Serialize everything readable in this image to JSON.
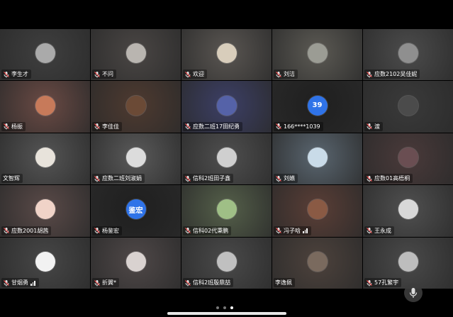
{
  "participants": [
    {
      "name": "李生才",
      "muted": true,
      "bg": "#3f3f3f",
      "avatar_bg": "#aaaaaa",
      "avatar_text": "",
      "signal": false
    },
    {
      "name": "不问",
      "muted": true,
      "bg": "#4a4644",
      "avatar_bg": "#b9b5b0",
      "avatar_text": "",
      "signal": false
    },
    {
      "name": "欢迎",
      "muted": true,
      "bg": "#5a5652",
      "avatar_bg": "#d8cdbb",
      "avatar_text": "",
      "signal": false
    },
    {
      "name": "刘洁",
      "muted": true,
      "bg": "#5c5a54",
      "avatar_bg": "#9b9c94",
      "avatar_text": "",
      "signal": false
    },
    {
      "name": "应数2102吴佳妮",
      "muted": true,
      "bg": "#4c4c4c",
      "avatar_bg": "#8f8f8f",
      "avatar_text": "",
      "signal": false
    },
    {
      "name": "杨振",
      "muted": true,
      "bg": "#6a4a44",
      "avatar_bg": "#c77a5a",
      "avatar_text": "",
      "signal": false
    },
    {
      "name": "李佳佳",
      "muted": true,
      "bg": "#4e3a30",
      "avatar_bg": "#6b4a36",
      "avatar_text": "",
      "signal": false
    },
    {
      "name": "应数二班17田纪勇",
      "muted": true,
      "bg": "#3c3f66",
      "avatar_bg": "#5562a8",
      "avatar_text": "",
      "signal": false
    },
    {
      "name": "166****1039",
      "muted": true,
      "bg": "#1f1f1f",
      "avatar_bg": "#2f73e8",
      "avatar_text": "39",
      "signal": false
    },
    {
      "name": "渡",
      "muted": true,
      "bg": "#3a3a3a",
      "avatar_bg": "#4b4b4b",
      "avatar_text": "",
      "signal": false
    },
    {
      "name": "文智辉",
      "muted": false,
      "bg": "#555555",
      "avatar_bg": "#e8e3db",
      "avatar_text": "",
      "signal": false
    },
    {
      "name": "应数二班刘淑娟",
      "muted": true,
      "bg": "#5a5a5a",
      "avatar_bg": "#dcdcdc",
      "avatar_text": "",
      "signal": false
    },
    {
      "name": "信科2班田子鑫",
      "muted": true,
      "bg": "#4f4f4f",
      "avatar_bg": "#cfcfcf",
      "avatar_text": "",
      "signal": false
    },
    {
      "name": "刘嬿",
      "muted": true,
      "bg": "#5a6670",
      "avatar_bg": "#c9dbe8",
      "avatar_text": "",
      "signal": false
    },
    {
      "name": "应数01高梧桐",
      "muted": true,
      "bg": "#4a3a3a",
      "avatar_bg": "#6a4e52",
      "avatar_text": "",
      "signal": false
    },
    {
      "name": "应数2001胡茜",
      "muted": true,
      "bg": "#5a4a48",
      "avatar_bg": "#f0d3c8",
      "avatar_text": "",
      "signal": false
    },
    {
      "name": "杨鉴宏",
      "muted": true,
      "bg": "#1f1f1f",
      "avatar_bg": "#2f73e8",
      "avatar_text": "鉴宏",
      "signal": false
    },
    {
      "name": "信科02代秉鹏",
      "muted": true,
      "bg": "#55604a",
      "avatar_bg": "#9fbf86",
      "avatar_text": "",
      "signal": false
    },
    {
      "name": "冯子晗",
      "muted": true,
      "bg": "#5a3e36",
      "avatar_bg": "#8a5a44",
      "avatar_text": "",
      "signal": true
    },
    {
      "name": "王永成",
      "muted": true,
      "bg": "#505050",
      "avatar_bg": "#d8d8d8",
      "avatar_text": "",
      "signal": false
    },
    {
      "name": "甘烟勇",
      "muted": true,
      "bg": "#474747",
      "avatar_bg": "#f2f2f2",
      "avatar_text": "",
      "signal": true
    },
    {
      "name": "折翼*",
      "muted": true,
      "bg": "#4f4848",
      "avatar_bg": "#d9d2d0",
      "avatar_text": "",
      "signal": false
    },
    {
      "name": "信科2班殷鼎喆",
      "muted": true,
      "bg": "#4a4a4a",
      "avatar_bg": "#c0c0c0",
      "avatar_text": "",
      "signal": false
    },
    {
      "name": "李逸佩",
      "muted": false,
      "bg": "#4d423c",
      "avatar_bg": "#7a6a5e",
      "avatar_text": "",
      "signal": false
    },
    {
      "name": "57孔繁宇",
      "muted": true,
      "bg": "#4a4a4a",
      "avatar_bg": "#bdbdbd",
      "avatar_text": "",
      "signal": false
    }
  ],
  "pager": {
    "count": 3,
    "active": 2
  },
  "colors": {
    "background": "#000000",
    "muted_icon": "#ff4d4f",
    "label_text": "#ffffff"
  }
}
